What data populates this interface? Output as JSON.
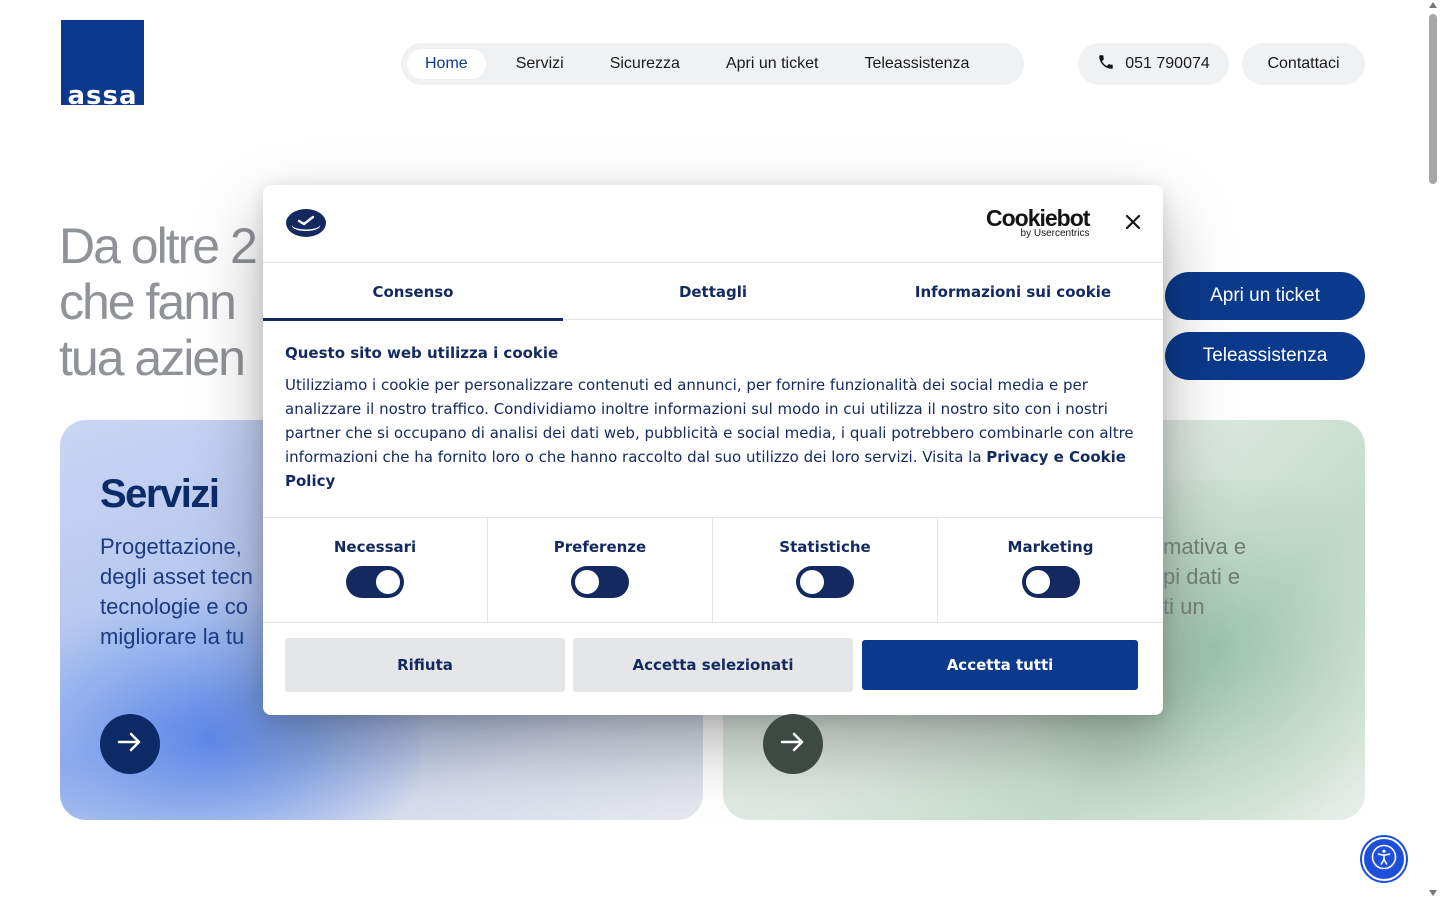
{
  "header": {
    "logo_text": "assa",
    "nav": [
      {
        "label": "Home"
      },
      {
        "label": "Servizi"
      },
      {
        "label": "Sicurezza"
      },
      {
        "label": "Apri un ticket"
      },
      {
        "label": "Teleassistenza"
      }
    ],
    "phone": "051 790074",
    "contact": "Contattaci"
  },
  "hero": {
    "title_line1": "Da oltre 2",
    "title_line2": "che fann",
    "title_line3": "tua azien",
    "cta_ticket": "Apri un ticket",
    "cta_teleassistenza": "Teleassistenza"
  },
  "cards": {
    "left": {
      "title": "Servizi",
      "desc": "Progettazione,\ndegli asset tecn\ntecnologie e co\nmigliorare la tu"
    },
    "right": {
      "desc": "mativa e\npi dati e\nti un"
    }
  },
  "cookie_dialog": {
    "brand_name": "Cookiebot",
    "brand_by": "by Usercentrics",
    "tabs": [
      {
        "label": "Consenso"
      },
      {
        "label": "Dettagli"
      },
      {
        "label": "Informazioni sui cookie"
      }
    ],
    "title": "Questo sito web utilizza i cookie",
    "body": "Utilizziamo i cookie per personalizzare contenuti ed annunci, per fornire funzionalità dei social media e per analizzare il nostro traffico. Condividiamo inoltre informazioni sul modo in cui utilizza il nostro sito con i nostri partner che si occupano di analisi dei dati web, pubblicità e social media, i quali potrebbero combinarle con altre informazioni che ha fornito loro o che hanno raccolto dal suo utilizzo dei loro servizi. Visita la ",
    "link": "Privacy e Cookie Policy",
    "categories": [
      {
        "label": "Necessari",
        "on": true
      },
      {
        "label": "Preferenze",
        "on": false
      },
      {
        "label": "Statistiche",
        "on": false
      },
      {
        "label": "Marketing",
        "on": false
      }
    ],
    "btn_deny": "Rifiuta",
    "btn_selected": "Accetta selezionati",
    "btn_all": "Accetta tutti"
  },
  "colors": {
    "brand": "#0b3a8c",
    "dialog_text": "#13295f"
  },
  "icons": [
    "phone-icon",
    "close-icon",
    "arrow-right-icon",
    "accessibility-icon",
    "cookiebot-logo-icon"
  ]
}
